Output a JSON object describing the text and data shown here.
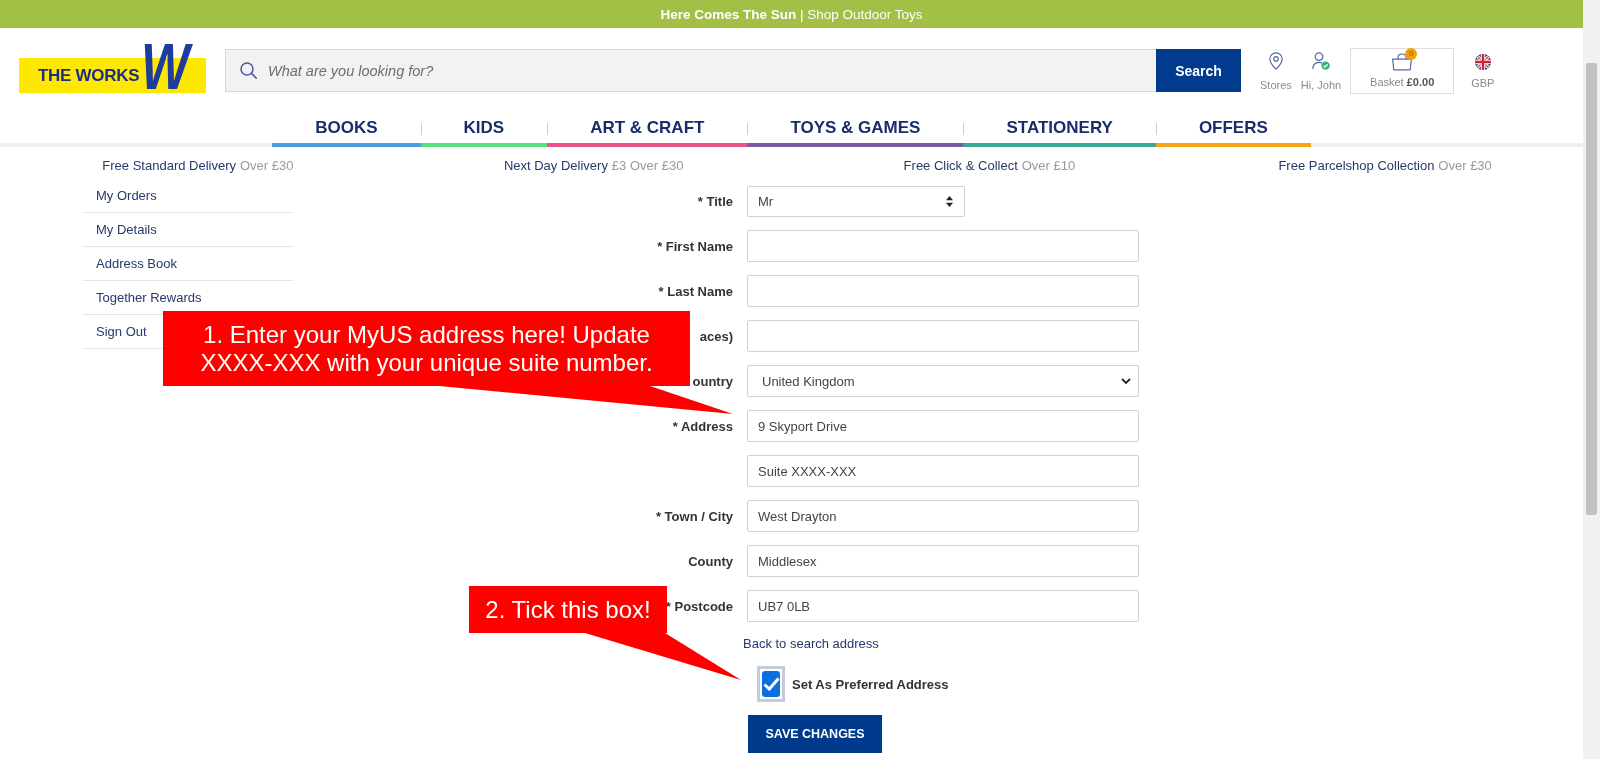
{
  "banner": {
    "text": "**Here Comes The Sun** | Shop Outdoor Toys"
  },
  "header": {
    "logo": {
      "text": "THE WORKS",
      "mark": "W"
    },
    "search": {
      "placeholder": "What are you looking for?",
      "button": "Search"
    },
    "tools": [
      {
        "kind": "stores",
        "label": "Stores"
      },
      {
        "kind": "account",
        "label": "Hi, John"
      },
      {
        "kind": "basket",
        "label": "Basket **£0.00**",
        "count": "0"
      },
      {
        "kind": "currency",
        "label": "GBP"
      }
    ]
  },
  "nav": [
    {
      "label": "BOOKS",
      "color": "#4a9de3"
    },
    {
      "label": "KIDS",
      "color": "#57e07c"
    },
    {
      "label": "ART & CRAFT",
      "color": "#e9518b"
    },
    {
      "label": "TOYS & GAMES",
      "color": "#7a5ba6"
    },
    {
      "label": "STATIONERY",
      "color": "#38a993"
    },
    {
      "label": "OFFERS",
      "color": "#f5a31a"
    }
  ],
  "delivery": [
    {
      "title": "Free Standard Delivery",
      "condition": "Over £30"
    },
    {
      "title": "Next Day Delivery",
      "condition": "£3 Over £30"
    },
    {
      "title": "Free Click & Collect",
      "condition": "Over £10"
    },
    {
      "title": "Free Parcelshop Collection",
      "condition": "Over £30"
    }
  ],
  "sidebar": [
    "My Orders",
    "My Details",
    "Address Book",
    "Together Rewards",
    "Sign Out"
  ],
  "form": {
    "fields": [
      {
        "kind": "picker",
        "label": "* Title",
        "value": "Mr"
      },
      {
        "kind": "text",
        "label": "* First Name"
      },
      {
        "kind": "text",
        "label": "* Last Name"
      },
      {
        "kind": "text",
        "label": "aces)"
      },
      {
        "kind": "dropdown",
        "label": "ountry",
        "value": "United Kingdom"
      },
      {
        "kind": "text",
        "label": "* Address",
        "value": "9 Skyport Drive"
      },
      {
        "kind": "text",
        "value": "Suite XXXX-XXX"
      },
      {
        "kind": "text",
        "label": "* Town / City",
        "value": "West Drayton"
      },
      {
        "kind": "text",
        "label": "County",
        "value": "Middlesex"
      },
      {
        "kind": "text",
        "label": "* Postcode",
        "value": "UB7 0LB"
      }
    ],
    "back_link": "Back to search address",
    "preferred": {
      "label": "Set As Preferred Address",
      "checked": true
    },
    "submit": "SAVE CHANGES"
  },
  "callouts": [
    {
      "text": "1. Enter your MyUS address here! Update XXXX-XXX with your unique suite number."
    },
    {
      "text": "2. Tick this box!"
    }
  ]
}
